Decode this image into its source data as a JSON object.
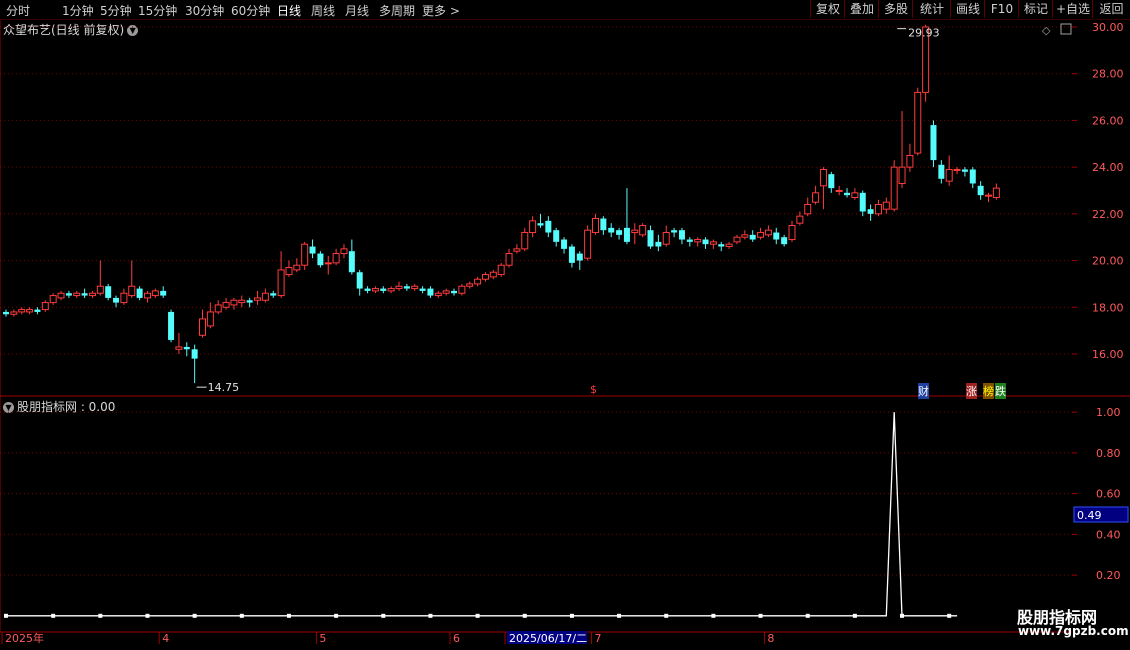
{
  "toolbar": {
    "periods": [
      "分时",
      "1分钟",
      "5分钟",
      "15分钟",
      "30分钟",
      "60分钟",
      "日线",
      "周线",
      "月线",
      "多周期",
      "更多"
    ],
    "active_period": "日线",
    "more_arrow": ">",
    "buttons": [
      "复权",
      "叠加",
      "多股",
      "统计",
      "画线",
      "F10",
      "标记",
      "+自选",
      "返回"
    ]
  },
  "main_chart": {
    "title": "众望布艺(日线 前复权)",
    "high_label": "29.93",
    "low_label": "14.75",
    "markers": {
      "dollar": "$",
      "cai": "财",
      "zhang": "涨",
      "bang": "榜",
      "die": "跌"
    }
  },
  "indicator": {
    "title": "股朋指标网 : 0.00",
    "current_value_box": "0.49"
  },
  "watermark": {
    "line1": "股朋指标网",
    "line2": "www.7gpzb.com"
  },
  "colors": {
    "up": "#ff3c3c",
    "down": "#54fcfc",
    "grid": "#7a0000",
    "axis": "#a00000",
    "line": "#ffffff",
    "value_box": "#000080"
  },
  "chart_data": [
    {
      "type": "candlestick",
      "title": "众望布艺(日线 前复权)",
      "y_ticks": [
        16.0,
        18.0,
        20.0,
        22.0,
        24.0,
        26.0,
        28.0,
        30.0
      ],
      "ylim": [
        14.2,
        30.3
      ],
      "x_month_labels": [
        {
          "label": "2025年",
          "index": 0
        },
        {
          "label": "4",
          "index": 20
        },
        {
          "label": "5",
          "index": 40
        },
        {
          "label": "6",
          "index": 57
        },
        {
          "label": "2025/06/17/二",
          "index": 64
        },
        {
          "label": "7",
          "index": 75
        },
        {
          "label": "8",
          "index": 97
        }
      ],
      "annotations": [
        {
          "label": "29.93",
          "index": 113,
          "value": 29.93
        },
        {
          "label": "14.75",
          "index": 24,
          "value": 14.75
        }
      ],
      "candles": [
        [
          17.8,
          17.7,
          17.9,
          17.6
        ],
        [
          17.7,
          17.8,
          17.9,
          17.6
        ],
        [
          17.8,
          17.9,
          18.0,
          17.7
        ],
        [
          17.8,
          17.9,
          18.0,
          17.7
        ],
        [
          17.9,
          17.8,
          18.0,
          17.7
        ],
        [
          17.9,
          18.2,
          18.3,
          17.8
        ],
        [
          18.2,
          18.5,
          18.6,
          18.1
        ],
        [
          18.4,
          18.6,
          18.7,
          18.3
        ],
        [
          18.6,
          18.5,
          18.7,
          18.4
        ],
        [
          18.5,
          18.6,
          18.7,
          18.4
        ],
        [
          18.6,
          18.5,
          18.8,
          18.4
        ],
        [
          18.5,
          18.6,
          18.7,
          18.4
        ],
        [
          18.6,
          18.9,
          20.0,
          18.5
        ],
        [
          18.9,
          18.4,
          19.0,
          18.3
        ],
        [
          18.4,
          18.2,
          18.5,
          18.0
        ],
        [
          18.2,
          18.6,
          18.8,
          18.1
        ],
        [
          18.5,
          18.9,
          20.0,
          18.4
        ],
        [
          18.8,
          18.4,
          18.9,
          18.3
        ],
        [
          18.4,
          18.6,
          18.7,
          18.2
        ],
        [
          18.5,
          18.7,
          18.8,
          18.4
        ],
        [
          18.7,
          18.5,
          18.9,
          18.4
        ],
        [
          17.8,
          16.6,
          17.9,
          16.5
        ],
        [
          16.2,
          16.3,
          16.9,
          16.0
        ],
        [
          16.3,
          16.2,
          16.5,
          15.9
        ],
        [
          16.2,
          15.8,
          16.4,
          14.75
        ],
        [
          16.8,
          17.5,
          17.9,
          16.7
        ],
        [
          17.2,
          17.8,
          18.2,
          17.1
        ],
        [
          17.8,
          18.1,
          18.3,
          17.7
        ],
        [
          18.0,
          18.2,
          18.4,
          17.9
        ],
        [
          18.1,
          18.3,
          18.4,
          17.9
        ],
        [
          18.2,
          18.3,
          18.5,
          18.0
        ],
        [
          18.3,
          18.2,
          18.4,
          18.0
        ],
        [
          18.3,
          18.4,
          18.7,
          18.1
        ],
        [
          18.3,
          18.6,
          18.8,
          18.2
        ],
        [
          18.6,
          18.5,
          18.7,
          18.4
        ],
        [
          18.5,
          19.6,
          20.4,
          18.4
        ],
        [
          19.4,
          19.7,
          20.0,
          19.3
        ],
        [
          19.6,
          19.8,
          20.1,
          19.5
        ],
        [
          19.8,
          20.7,
          20.8,
          19.6
        ],
        [
          20.6,
          20.3,
          20.9,
          20.1
        ],
        [
          20.3,
          19.8,
          20.4,
          19.7
        ],
        [
          19.9,
          19.9,
          20.2,
          19.4
        ],
        [
          19.9,
          20.3,
          20.5,
          19.8
        ],
        [
          20.3,
          20.5,
          20.7,
          20.1
        ],
        [
          20.4,
          19.5,
          20.9,
          19.4
        ],
        [
          19.5,
          18.8,
          19.6,
          18.5
        ],
        [
          18.8,
          18.7,
          18.9,
          18.6
        ],
        [
          18.7,
          18.8,
          18.9,
          18.6
        ],
        [
          18.8,
          18.7,
          18.9,
          18.6
        ],
        [
          18.7,
          18.8,
          18.9,
          18.6
        ],
        [
          18.8,
          18.9,
          19.1,
          18.7
        ],
        [
          18.9,
          18.8,
          19.0,
          18.7
        ],
        [
          18.8,
          18.9,
          19.0,
          18.7
        ],
        [
          18.8,
          18.7,
          18.9,
          18.6
        ],
        [
          18.8,
          18.5,
          18.9,
          18.4
        ],
        [
          18.5,
          18.6,
          18.7,
          18.4
        ],
        [
          18.6,
          18.7,
          18.8,
          18.5
        ],
        [
          18.7,
          18.6,
          18.8,
          18.5
        ],
        [
          18.6,
          18.9,
          19.0,
          18.5
        ],
        [
          18.9,
          19.0,
          19.1,
          18.8
        ],
        [
          19.0,
          19.2,
          19.3,
          18.9
        ],
        [
          19.2,
          19.4,
          19.5,
          19.1
        ],
        [
          19.3,
          19.5,
          19.6,
          19.2
        ],
        [
          19.4,
          19.8,
          19.9,
          19.3
        ],
        [
          19.8,
          20.3,
          20.5,
          19.7
        ],
        [
          20.4,
          20.5,
          20.7,
          20.3
        ],
        [
          20.5,
          21.2,
          21.4,
          20.4
        ],
        [
          21.2,
          21.7,
          21.9,
          21.0
        ],
        [
          21.6,
          21.5,
          22.0,
          21.4
        ],
        [
          21.7,
          21.2,
          21.9,
          21.0
        ],
        [
          21.3,
          20.8,
          21.4,
          20.6
        ],
        [
          20.9,
          20.5,
          21.0,
          20.3
        ],
        [
          20.6,
          19.9,
          20.7,
          19.7
        ],
        [
          20.3,
          20.0,
          20.4,
          19.6
        ],
        [
          20.1,
          21.3,
          21.5,
          20.0
        ],
        [
          21.2,
          21.8,
          22.0,
          21.1
        ],
        [
          21.8,
          21.3,
          21.9,
          21.1
        ],
        [
          21.4,
          21.2,
          21.6,
          21.0
        ],
        [
          21.3,
          21.1,
          21.4,
          20.9
        ],
        [
          21.4,
          20.8,
          23.1,
          20.7
        ],
        [
          21.2,
          21.3,
          21.6,
          20.7
        ],
        [
          21.1,
          21.5,
          21.6,
          21.0
        ],
        [
          21.3,
          20.6,
          21.5,
          20.5
        ],
        [
          20.8,
          20.6,
          21.1,
          20.4
        ],
        [
          20.7,
          21.2,
          21.5,
          20.6
        ],
        [
          21.3,
          21.2,
          21.4,
          21.0
        ],
        [
          21.3,
          20.9,
          21.4,
          20.7
        ],
        [
          20.9,
          20.8,
          21.0,
          20.6
        ],
        [
          20.8,
          20.9,
          21.0,
          20.6
        ],
        [
          20.9,
          20.7,
          21.0,
          20.5
        ],
        [
          20.7,
          20.8,
          20.9,
          20.5
        ],
        [
          20.7,
          20.6,
          20.8,
          20.4
        ],
        [
          20.6,
          20.7,
          20.8,
          20.5
        ],
        [
          20.8,
          21.0,
          21.1,
          20.7
        ],
        [
          21.0,
          21.1,
          21.3,
          20.9
        ],
        [
          21.1,
          20.9,
          21.3,
          20.8
        ],
        [
          21.0,
          21.2,
          21.4,
          20.9
        ],
        [
          21.1,
          21.3,
          21.5,
          21.0
        ],
        [
          21.2,
          20.9,
          21.4,
          20.7
        ],
        [
          21.0,
          20.7,
          21.1,
          20.6
        ],
        [
          20.9,
          21.5,
          21.7,
          20.8
        ],
        [
          21.6,
          21.9,
          22.1,
          21.5
        ],
        [
          22.0,
          22.4,
          22.7,
          21.9
        ],
        [
          22.5,
          22.9,
          23.2,
          22.4
        ],
        [
          23.2,
          23.9,
          24.0,
          22.2
        ],
        [
          23.7,
          23.1,
          23.8,
          22.9
        ],
        [
          23.0,
          23.0,
          23.2,
          22.8
        ],
        [
          22.9,
          22.8,
          23.1,
          22.7
        ],
        [
          22.7,
          22.9,
          23.1,
          22.6
        ],
        [
          22.9,
          22.1,
          23.0,
          21.9
        ],
        [
          22.2,
          22.0,
          22.4,
          21.7
        ],
        [
          22.0,
          22.4,
          22.6,
          21.9
        ],
        [
          22.2,
          22.5,
          22.7,
          22.0
        ],
        [
          22.2,
          24.0,
          24.3,
          22.1
        ],
        [
          23.3,
          24.0,
          26.4,
          23.1
        ],
        [
          24.0,
          24.5,
          25.0,
          23.8
        ],
        [
          24.6,
          27.2,
          27.4,
          24.5
        ],
        [
          27.2,
          30.0,
          30.1,
          26.8
        ],
        [
          25.8,
          24.3,
          26.0,
          24.0
        ],
        [
          24.1,
          23.5,
          24.3,
          23.3
        ],
        [
          23.4,
          23.9,
          24.5,
          23.2
        ],
        [
          23.9,
          23.9,
          24.0,
          23.7
        ],
        [
          23.9,
          23.8,
          24.0,
          23.6
        ],
        [
          23.9,
          23.3,
          24.0,
          23.1
        ],
        [
          23.2,
          22.8,
          23.4,
          22.6
        ],
        [
          22.8,
          22.8,
          22.9,
          22.5
        ],
        [
          22.7,
          23.1,
          23.3,
          22.6
        ]
      ]
    },
    {
      "type": "line",
      "title": "股朋指标网",
      "y_ticks": [
        0.2,
        0.4,
        0.6,
        0.8,
        1.0
      ],
      "ylim": [
        -0.05,
        1.05
      ],
      "values_note_omitted": false,
      "values": [
        0,
        0,
        0,
        0,
        0,
        0,
        0,
        0,
        0,
        0,
        0,
        0,
        0,
        0,
        0,
        0,
        0,
        0,
        0,
        0,
        0,
        0,
        0,
        0,
        0,
        0,
        0,
        0,
        0,
        0,
        0,
        0,
        0,
        0,
        0,
        0,
        0,
        0,
        0,
        0,
        0,
        0,
        0,
        0,
        0,
        0,
        0,
        0,
        0,
        0,
        0,
        0,
        0,
        0,
        0,
        0,
        0,
        0,
        0,
        0,
        0,
        0,
        0,
        0,
        0,
        0,
        0,
        0,
        0,
        0,
        0,
        0,
        0,
        0,
        0,
        0,
        0,
        0,
        0,
        0,
        0,
        0,
        0,
        0,
        0,
        0,
        0,
        0,
        0,
        0,
        0,
        0,
        0,
        0,
        0,
        0,
        0,
        0,
        0,
        0,
        0,
        0,
        0,
        0,
        0,
        0,
        0,
        0,
        0,
        0,
        0,
        0,
        0,
        1,
        0,
        0,
        0,
        0,
        0,
        0,
        0,
        0
      ],
      "current_value": 0.49
    }
  ]
}
